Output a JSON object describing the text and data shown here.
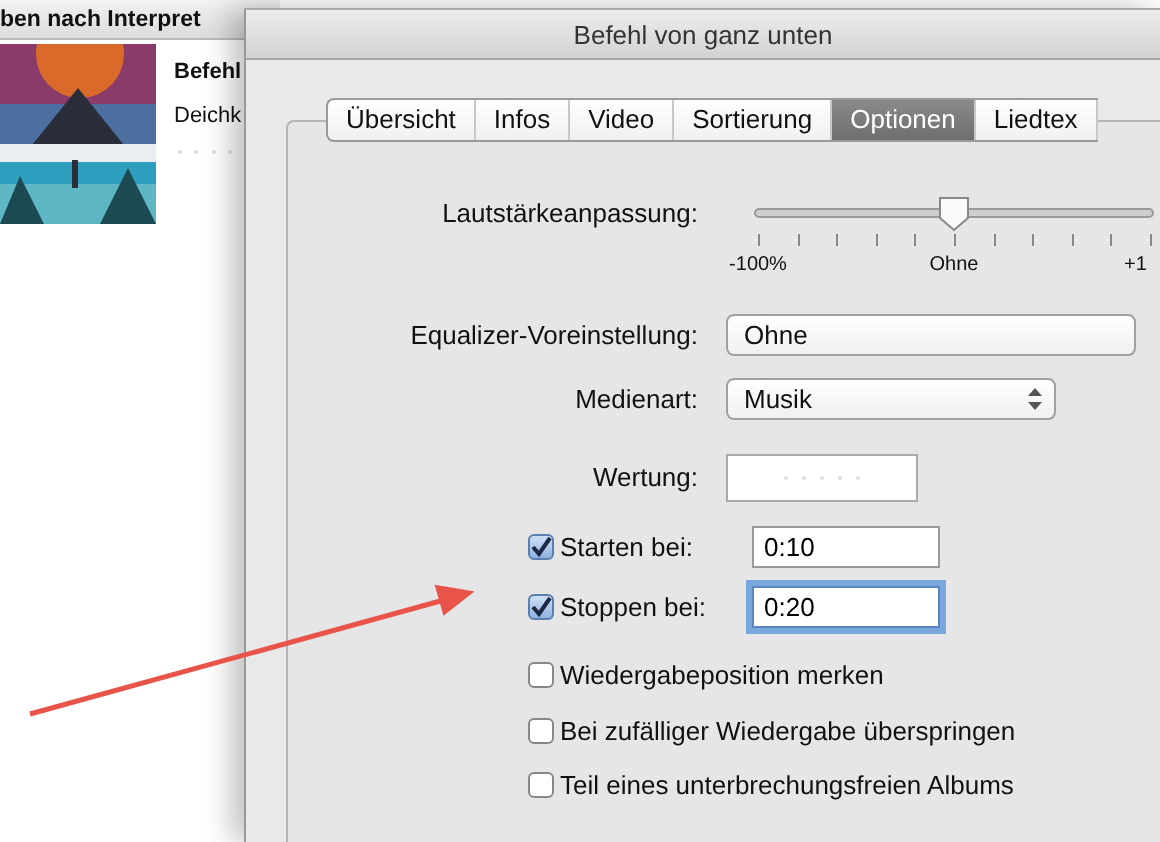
{
  "background_window": {
    "header": "ben nach Interpret",
    "track_title": "Befehl",
    "artist": "Deichk",
    "stars": 0
  },
  "dialog": {
    "title": "Befehl von ganz unten",
    "tabs": [
      {
        "label": "Übersicht",
        "selected": false
      },
      {
        "label": "Infos",
        "selected": false
      },
      {
        "label": "Video",
        "selected": false
      },
      {
        "label": "Sortierung",
        "selected": false
      },
      {
        "label": "Optionen",
        "selected": true
      },
      {
        "label": "Liedtex",
        "selected": false
      }
    ],
    "volume": {
      "label": "Lautstärkeanpassung:",
      "level": 0.5,
      "tick_labels": [
        "-100%",
        "Ohne",
        "+1"
      ]
    },
    "equalizer": {
      "label": "Equalizer-Voreinstellung:",
      "value": "Ohne"
    },
    "media_type": {
      "label": "Medienart:",
      "value": "Musik"
    },
    "rating": {
      "label": "Wertung:",
      "stars": 0
    },
    "start": {
      "label": "Starten bei:",
      "checked": true,
      "value": "0:10",
      "focused": false
    },
    "stop": {
      "label": "Stoppen bei:",
      "checked": true,
      "value": "0:20",
      "focused": true
    },
    "options": [
      {
        "label": "Wiedergabeposition merken",
        "checked": false
      },
      {
        "label": "Bei zufälliger Wiedergabe überspringen",
        "checked": false
      },
      {
        "label": "Teil eines unterbrechungsfreien Albums",
        "checked": false
      }
    ]
  },
  "annotation": {
    "kind": "arrow",
    "color": "#e8544a"
  }
}
